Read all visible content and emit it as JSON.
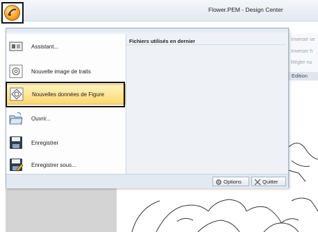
{
  "window": {
    "title": "Flower.PEM - Design Center"
  },
  "ribbon": {
    "items": [
      "Inverser ve",
      "Inverser h",
      "Régler nu"
    ],
    "group_label": "Edition"
  },
  "menu": {
    "items": [
      {
        "label": "Assistant...",
        "icon": "wizard-icon"
      },
      {
        "label": "Nouvelle image de traits",
        "icon": "new-line-image-icon"
      },
      {
        "label": "Nouvelles données de Figure",
        "icon": "new-figure-data-icon",
        "highlighted": true
      },
      {
        "label": "Ouvrir...",
        "icon": "folder-open-icon"
      },
      {
        "label": "Enregistrer",
        "icon": "save-icon"
      },
      {
        "label": "Enregistrer sous...",
        "icon": "save-as-icon"
      }
    ],
    "recent_title": "Fichiers utilisés en dernier",
    "options_label": "Options",
    "quit_label": "Quitter"
  },
  "colors": {
    "highlight": "#fcd86e",
    "menu_bg": "#eef2f7",
    "app_button": "#f59a1e"
  }
}
